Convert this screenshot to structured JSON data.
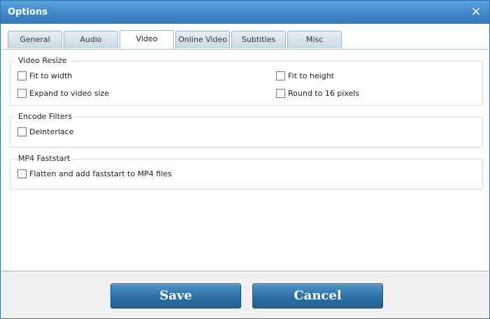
{
  "window": {
    "title": "Options",
    "close_icon": "×"
  },
  "tabs": [
    {
      "label": "General",
      "active": false
    },
    {
      "label": "Audio",
      "active": false
    },
    {
      "label": "Video",
      "active": true
    },
    {
      "label": "Online Video",
      "active": false
    },
    {
      "label": "Subtitles",
      "active": false
    },
    {
      "label": "Misc",
      "active": false
    }
  ],
  "video_resize": {
    "legend": "Video Resize",
    "fit_to_width": {
      "label": "Fit to width",
      "checked": false
    },
    "fit_to_height": {
      "label": "Fit to height",
      "checked": false
    },
    "expand_to_video_size": {
      "label": "Expand to video size",
      "checked": false
    },
    "round_to_16_pixels": {
      "label": "Round to 16 pixels",
      "checked": false
    }
  },
  "encode_filters": {
    "legend": "Encode Filters",
    "deinterlace": {
      "label": "Deinterlace",
      "checked": false
    }
  },
  "mp4_faststart": {
    "legend": "MP4 Faststart",
    "flatten": {
      "label": "Flatten and add faststart to MP4 files",
      "checked": false
    }
  },
  "footer": {
    "save_label": "Save",
    "cancel_label": "Cancel"
  }
}
